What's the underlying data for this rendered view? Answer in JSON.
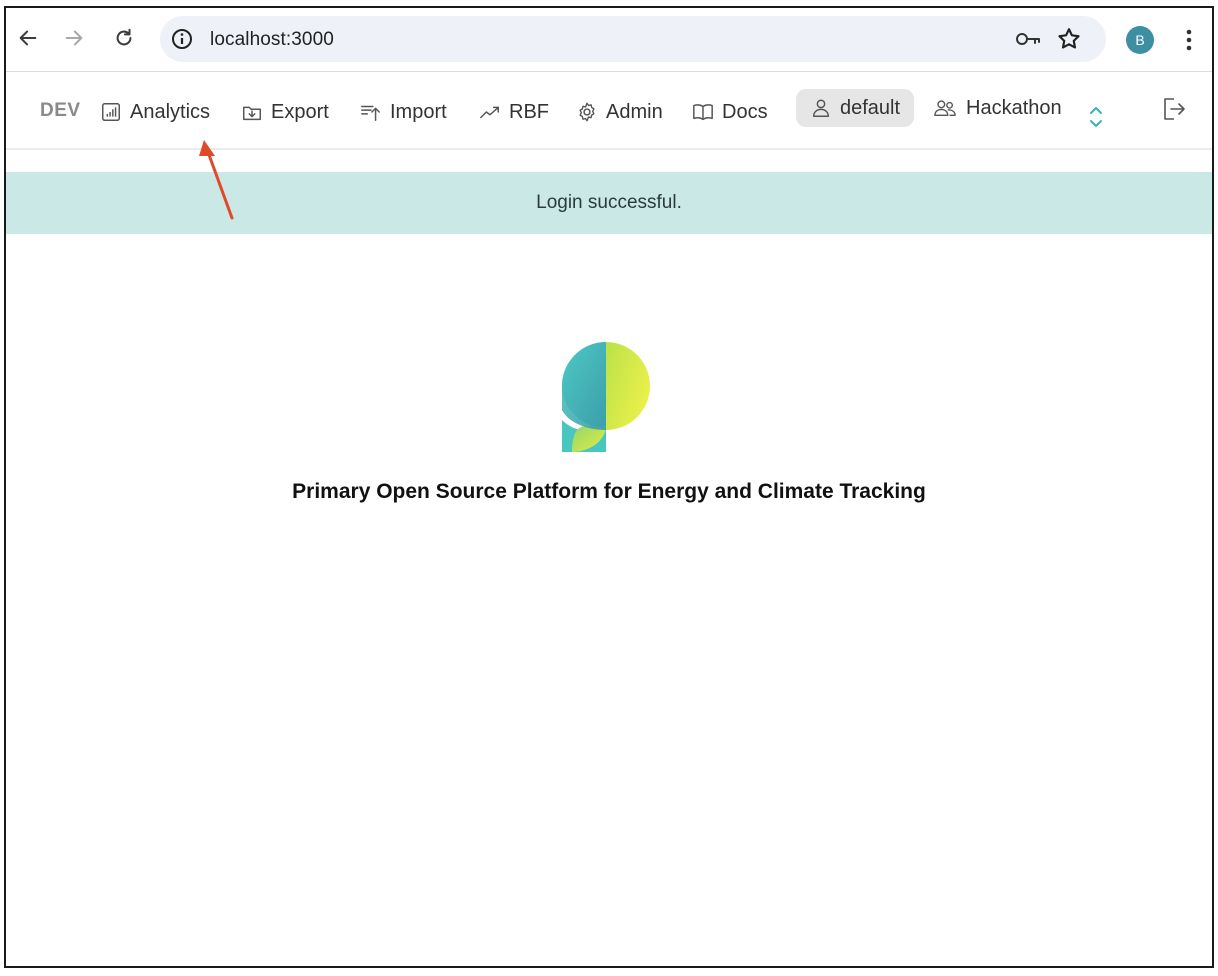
{
  "browser": {
    "url": "localhost:3000",
    "profile_initial": "B",
    "icons": {
      "back": "arrow-left-icon",
      "forward": "arrow-right-icon",
      "reload": "reload-icon",
      "info": "info-icon",
      "key": "key-icon",
      "bookmark": "star-icon",
      "menu": "kebab-menu-icon"
    }
  },
  "nav": {
    "env_label": "DEV",
    "items": [
      {
        "label": "Analytics",
        "icon": "bar-chart-icon"
      },
      {
        "label": "Export",
        "icon": "export-icon"
      },
      {
        "label": "Import",
        "icon": "import-icon"
      },
      {
        "label": "RBF",
        "icon": "trend-icon"
      },
      {
        "label": "Admin",
        "icon": "gear-icon"
      },
      {
        "label": "Docs",
        "icon": "book-icon"
      }
    ],
    "user_label": "default",
    "org_label": "Hackathon",
    "accent_color": "#3bb3b5"
  },
  "banner": {
    "message": "Login successful.",
    "background": "#c9e8e6"
  },
  "main": {
    "tagline": "Primary Open Source Platform for Energy and Climate Tracking"
  },
  "annotation": {
    "color": "#e04a2b"
  }
}
